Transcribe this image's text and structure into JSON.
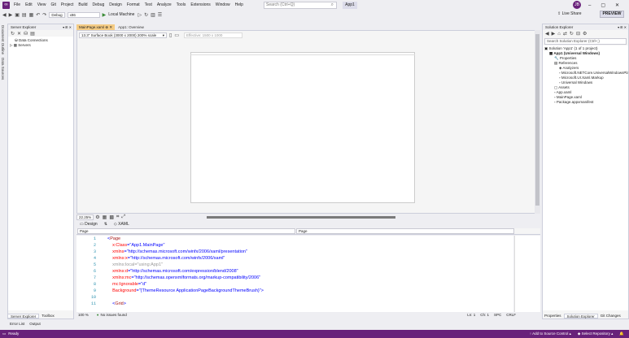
{
  "window": {
    "menus": [
      "File",
      "Edit",
      "View",
      "Git",
      "Project",
      "Build",
      "Debug",
      "Design",
      "Format",
      "Test",
      "Analyze",
      "Tools",
      "Extensions",
      "Window",
      "Help"
    ],
    "search_placeholder": "Search (Ctrl+Q)",
    "project_name": "App1",
    "avatar_initials": "JB",
    "accent": "#68217a"
  },
  "toolbar": {
    "config": "Debug",
    "platform": "x86",
    "run_target": "Local Machine",
    "live_share": "Live Share",
    "preview": "PREVIEW"
  },
  "left_tool_tabs": [
    "Document Outline",
    "Data Sources"
  ],
  "server_explorer": {
    "title": "Server Explorer",
    "items": [
      "Data Connections",
      "Servers"
    ],
    "bottom_tabs": [
      "Server Explorer",
      "Toolbox"
    ],
    "output_tabs": [
      "Error List",
      "Output"
    ]
  },
  "doc_tabs": [
    "MainPage.xaml",
    "App1: Overview"
  ],
  "designer": {
    "device": "13.3\" Surface Book (3000 x 2000) 200% scale",
    "effective": "Effective: 1500 x 1000",
    "zoom": "22.25%",
    "design_tab": "Design",
    "xaml_tab": "XAML",
    "left_selector": "Page",
    "right_selector": "Page"
  },
  "code": {
    "line_numbers": [
      "1",
      "2",
      "3",
      "4",
      "5",
      "6",
      "7",
      "8",
      "9",
      "10",
      "11"
    ],
    "lines": [
      {
        "parts": [
          [
            "p",
            "<"
          ],
          [
            "k",
            "Page"
          ]
        ]
      },
      {
        "parts": [
          [
            "a",
            "    x:Class"
          ],
          [
            "p",
            "="
          ],
          [
            "v",
            "\"App1.MainPage\""
          ]
        ]
      },
      {
        "parts": [
          [
            "a",
            "    xmlns"
          ],
          [
            "p",
            "="
          ],
          [
            "v",
            "\"http://schemas.microsoft.com/winfx/2006/xaml/presentation\""
          ]
        ]
      },
      {
        "parts": [
          [
            "a",
            "    xmlns:x"
          ],
          [
            "p",
            "="
          ],
          [
            "v",
            "\"http://schemas.microsoft.com/winfx/2006/xaml\""
          ]
        ]
      },
      {
        "parts": [
          [
            "d",
            "    xmlns:local=\"using:App1\""
          ]
        ]
      },
      {
        "parts": [
          [
            "a",
            "    xmlns:d"
          ],
          [
            "p",
            "="
          ],
          [
            "v",
            "\"http://schemas.microsoft.com/expression/blend/2008\""
          ]
        ]
      },
      {
        "parts": [
          [
            "a",
            "    xmlns:mc"
          ],
          [
            "p",
            "="
          ],
          [
            "v",
            "\"http://schemas.openxmlformats.org/markup-compatibility/2006\""
          ]
        ]
      },
      {
        "parts": [
          [
            "a",
            "    mc:Ignorable"
          ],
          [
            "p",
            "="
          ],
          [
            "v",
            "\"d\""
          ]
        ]
      },
      {
        "parts": [
          [
            "a",
            "    Background"
          ],
          [
            "p",
            "="
          ],
          [
            "v",
            "\"{ThemeResource ApplicationPageBackgroundThemeBrush}\""
          ],
          [
            "p",
            ">"
          ]
        ]
      },
      {
        "parts": []
      },
      {
        "parts": [
          [
            "p",
            "    <"
          ],
          [
            "k",
            "Grid"
          ],
          [
            "p",
            ">"
          ]
        ]
      }
    ]
  },
  "editor_status": {
    "zoom": "100 %",
    "issues": "No issues found",
    "ln": "Ln: 1",
    "ch": "Ch: 1",
    "spc": "SPC",
    "crlf": "CRLF"
  },
  "solution_explorer": {
    "title": "Solution Explorer",
    "search_placeholder": "Search Solution Explorer (Ctrl+;)",
    "items": [
      {
        "label": "Solution 'App1' (1 of 1 project)",
        "indent": 0,
        "bold": false
      },
      {
        "label": "App1 (Universal Windows)",
        "indent": 1,
        "bold": true
      },
      {
        "label": "Properties",
        "indent": 2,
        "bold": false
      },
      {
        "label": "References",
        "indent": 2,
        "bold": false
      },
      {
        "label": "Analyzers",
        "indent": 3,
        "bold": false
      },
      {
        "label": "Microsoft.NETCore.UniversalWindowsPlatform",
        "indent": 3,
        "bold": false
      },
      {
        "label": "Microsoft.UI.Xaml.Markup",
        "indent": 3,
        "bold": false
      },
      {
        "label": "Universal Windows",
        "indent": 3,
        "bold": false
      },
      {
        "label": "Assets",
        "indent": 2,
        "bold": false
      },
      {
        "label": "App.xaml",
        "indent": 2,
        "bold": false
      },
      {
        "label": "MainPage.xaml",
        "indent": 2,
        "bold": false
      },
      {
        "label": "Package.appxmanifest",
        "indent": 2,
        "bold": false
      }
    ],
    "bottom_tabs": [
      "Properties",
      "Solution Explorer",
      "Git Changes"
    ]
  },
  "status": {
    "ready": "Ready",
    "add_source": "Add to Source Control",
    "select_repo": "Select Repository"
  }
}
